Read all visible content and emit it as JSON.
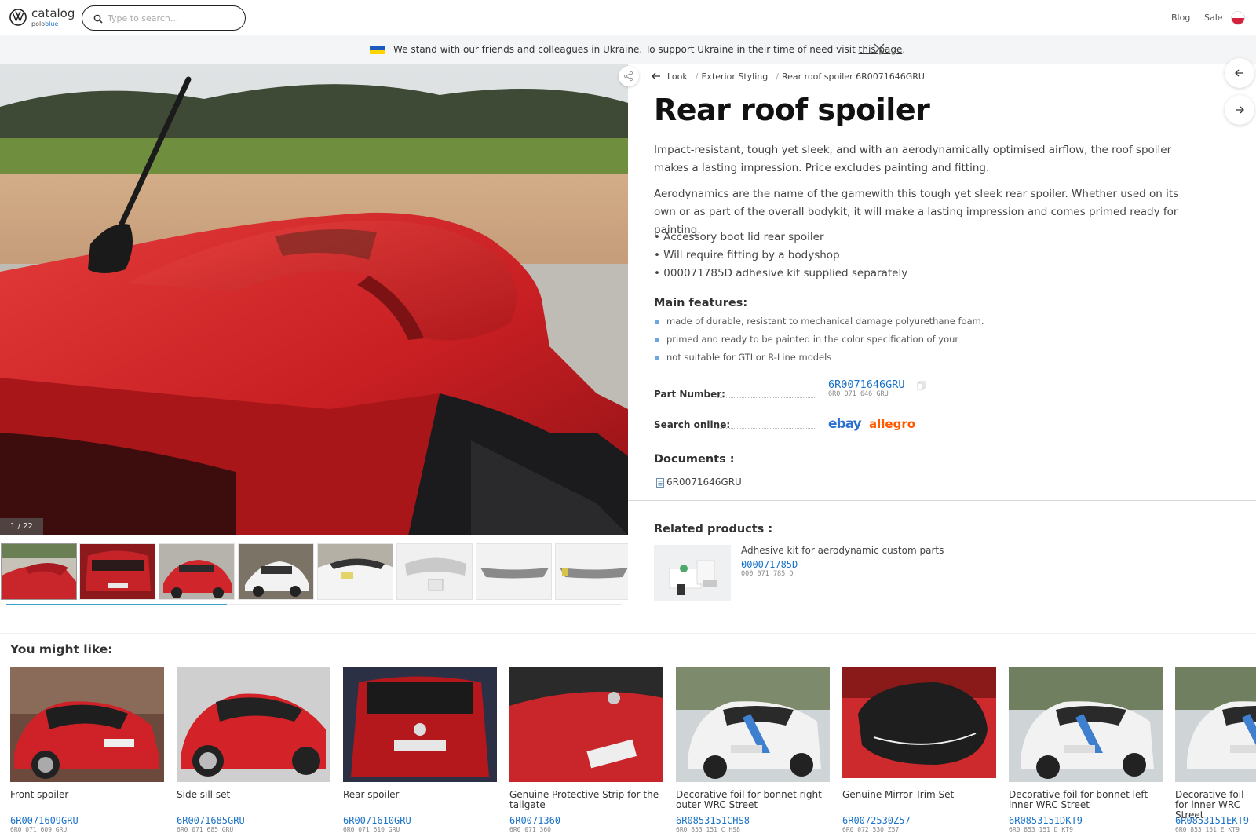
{
  "header": {
    "brand": "catalog",
    "brand_sub_prefix": "polo",
    "brand_sub_suffix": "blue",
    "search_placeholder": "Type to search...",
    "nav_blog": "Blog",
    "nav_sale": "Sale"
  },
  "banner": {
    "text_before": "We stand with our friends and colleagues in Ukraine. To support Ukraine in their time of need visit ",
    "link": "this page",
    "text_after": "."
  },
  "gallery": {
    "counter": "1 / 22"
  },
  "breadcrumb": {
    "back": "Look",
    "category": "Exterior Styling",
    "current": "Rear roof spoiler 6R0071646GRU"
  },
  "product": {
    "title": "Rear roof spoiler",
    "desc1": "Impact-resistant, tough yet sleek, and with an aerodynamically optimised airflow, the roof spoiler makes a lasting impression. Price excludes painting and fitting.",
    "desc2": "Aerodynamics are the name of the gamewith this tough yet sleek rear spoiler. Whether used on its own or as part of the overall bodykit, it will make a lasting impression and comes primed ready for painting.",
    "bullets": [
      "• Accessory boot lid rear spoiler",
      "• Will require fitting by a bodyshop",
      "• 000071785D adhesive kit supplied separately"
    ],
    "features_heading": "Main features:",
    "features": [
      "made of durable, resistant to mechanical damage polyurethane foam.",
      "primed and ready to be painted in the color specification of your",
      "not suitable for GTI or R-Line models"
    ],
    "part_label": "Part Number:",
    "part_number": "6R0071646GRU",
    "part_number_spaced": "6R0 071 646 GRU",
    "search_label": "Search online:",
    "ebay": "ebay",
    "allegro": "allegro",
    "documents_heading": "Documents :",
    "document": "6R0071646GRU"
  },
  "related": {
    "heading": "Related products :",
    "title": "Adhesive kit for aerodynamic custom parts",
    "number": "000071785D",
    "number_spaced": "000 071 785 D"
  },
  "you_might_like": {
    "heading": "You might like:",
    "items": [
      {
        "title": "Front spoiler",
        "number": "6R0071609GRU",
        "spaced": "6R0 071 609 GRU"
      },
      {
        "title": "Side sill set",
        "number": "6R0071685GRU",
        "spaced": "6R0 071 685 GRU"
      },
      {
        "title": "Rear spoiler",
        "number": "6R0071610GRU",
        "spaced": "6R0 071 610 GRU"
      },
      {
        "title": "Genuine Protective Strip for the tailgate",
        "number": "6R0071360",
        "spaced": "6R0 071 360"
      },
      {
        "title": "Decorative foil for bonnet right outer WRC Street",
        "number": "6R0853151CHS8",
        "spaced": "6R0 853 151 C HS8"
      },
      {
        "title": "Genuine Mirror Trim Set",
        "number": "6R0072530Z57",
        "spaced": "6R0 072 530 Z57"
      },
      {
        "title": "Decorative foil for bonnet left inner WRC Street",
        "number": "6R0853151DKT9",
        "spaced": "6R0 853 151 D KT9"
      },
      {
        "title": "Decorative foil for inner WRC Street",
        "number": "6R0853151EKT9",
        "spaced": "6R0 853 151 E KT9"
      }
    ]
  }
}
